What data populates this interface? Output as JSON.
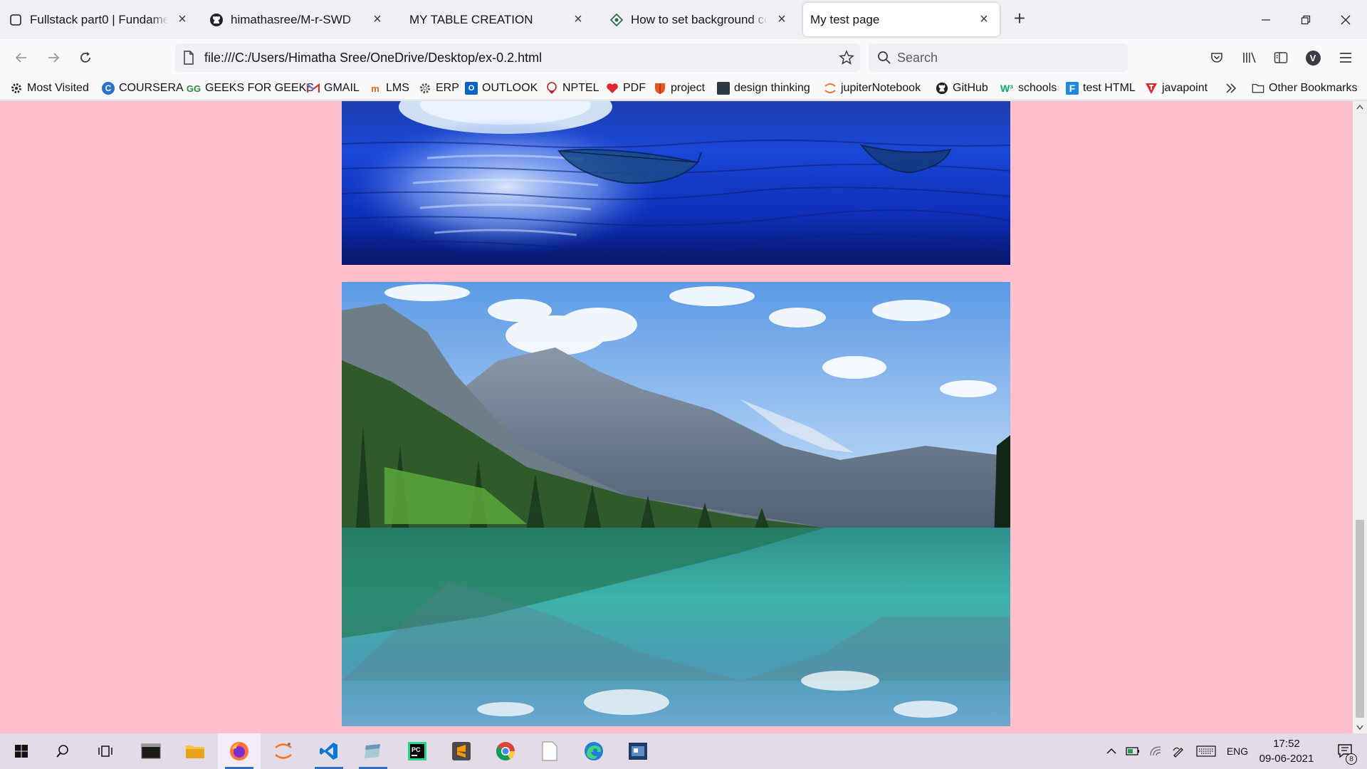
{
  "tabs": [
    {
      "title": "Fullstack part0 | Fundamentals of Web apps",
      "icon": "page-icon"
    },
    {
      "title": "himathasree/M-r-SWD",
      "icon": "github-icon"
    },
    {
      "title": "MY TABLE CREATION",
      "icon": "none"
    },
    {
      "title": "How to set background color",
      "icon": "diamond-icon"
    },
    {
      "title": "My test page",
      "icon": "none",
      "active": true
    }
  ],
  "nav": {
    "url": "file:///C:/Users/Himatha Sree/OneDrive/Desktop/ex-0.2.html",
    "search_placeholder": "Search",
    "profile_letter": "V"
  },
  "bookmarks": [
    {
      "label": "Most Visited",
      "icon": "gear-icon"
    },
    {
      "label": "COURSERA",
      "icon": "coursera-icon"
    },
    {
      "label": "GEEKS FOR GEEKS",
      "icon": "gfg-icon"
    },
    {
      "label": "GMAIL",
      "icon": "gmail-icon"
    },
    {
      "label": "LMS",
      "icon": "lms-icon"
    },
    {
      "label": "ERP",
      "icon": "gear-icon"
    },
    {
      "label": "OUTLOOK",
      "icon": "outlook-icon"
    },
    {
      "label": "NPTEL",
      "icon": "nptel-icon"
    },
    {
      "label": "PDF",
      "icon": "heart-icon"
    },
    {
      "label": "project",
      "icon": "shield-icon"
    },
    {
      "label": "design thinking",
      "icon": "book-icon"
    },
    {
      "label": "jupiterNotebook",
      "icon": "jupyter-icon"
    },
    {
      "label": "GitHub",
      "icon": "github-icon"
    },
    {
      "label": "schools",
      "icon": "w3-icon"
    },
    {
      "label": "test HTML",
      "icon": "f-icon"
    },
    {
      "label": "javapoint",
      "icon": "t-icon"
    }
  ],
  "other_bookmarks": "Other Bookmarks",
  "page": {
    "background": "#ffc0cb",
    "images": [
      {
        "name": "moon-lake-leaves-image"
      },
      {
        "name": "mountain-lake-image"
      }
    ]
  },
  "taskbar": {
    "language": "ENG",
    "time": "17:52",
    "date": "09-06-2021",
    "notification_count": "8"
  }
}
